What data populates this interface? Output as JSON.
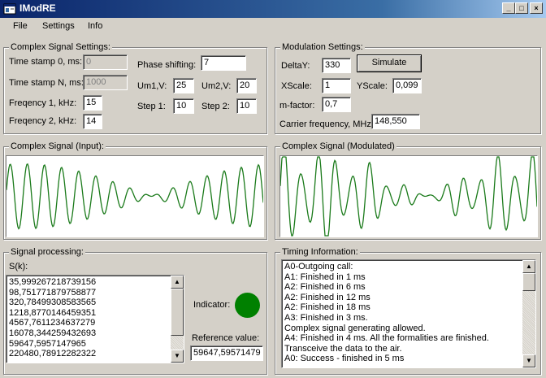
{
  "window": {
    "title": "IModRE",
    "controls": {
      "minimize": "_",
      "maximize": "□",
      "close": "×"
    }
  },
  "menu": [
    "File",
    "Settings",
    "Info"
  ],
  "complex_settings": {
    "title": "Complex Signal Settings:",
    "timestamp0_label": "Time stamp 0, ms:",
    "timestamp0_value": "0",
    "timestampN_label": "Time stamp N, ms:",
    "timestampN_value": "1000",
    "freq1_label": "Freqency 1, kHz:",
    "freq1_value": "15",
    "freq2_label": "Freqency 2, kHz:",
    "freq2_value": "14",
    "phase_label": "Phase shifting:",
    "phase_value": "7",
    "um1_label": "Um1,V:",
    "um1_value": "25",
    "um2_label": "Um2,V:",
    "um2_value": "20",
    "step1_label": "Step 1:",
    "step1_value": "10",
    "step2_label": "Step 2:",
    "step2_value": "10"
  },
  "modulation_settings": {
    "title": "Modulation Settings:",
    "deltay_label": "DeltaY:",
    "deltay_value": "330",
    "simulate_label": "Simulate",
    "xscale_label": "XScale:",
    "xscale_value": "1",
    "yscale_label": "YScale:",
    "yscale_value": "0,099",
    "mfactor_label": "m-factor:",
    "mfactor_value": "0,7",
    "carrier_label": "Carrier frequency, MHz:",
    "carrier_value": "148,550"
  },
  "input_plot": {
    "title": "Complex Signal (Input):"
  },
  "modulated_plot": {
    "title": "Complex Signal (Modulated)"
  },
  "signal_processing": {
    "title": "Signal processing:",
    "s_label": "S(k):",
    "values": [
      "35,999267218739156",
      "98,751771879758877",
      "320,78499308583565",
      "1218,8770146459351",
      "4567,7611234637279",
      "16078,344259432693",
      "59647,5957147965",
      "220480,78912282322"
    ],
    "indicator_label": "Indicator:",
    "indicator_color": "#008000",
    "reference_label": "Reference value:",
    "reference_value": "59647,59571479"
  },
  "timing": {
    "title": "Timing Information:",
    "lines": [
      "A0-Outgoing call:",
      "A1: Finished in 1 ms",
      "A2: Finished in 6 ms",
      "A2: Finished in 12 ms",
      "A2: Finished in 18 ms",
      "A3: Finished in 3 ms.",
      "Complex signal generating allowed.",
      "A4: Finished in 4 ms. All the formalities are finished.",
      "Transceive the data to the air.",
      "A0: Success - finished in 5 ms"
    ]
  },
  "colors": {
    "signal_line": "#1a7a1a",
    "window_bg": "#d4d0c8",
    "titlebar": "#0a246a"
  },
  "icons": {
    "app": "app-icon",
    "scroll_up": "▲",
    "scroll_down": "▼"
  }
}
